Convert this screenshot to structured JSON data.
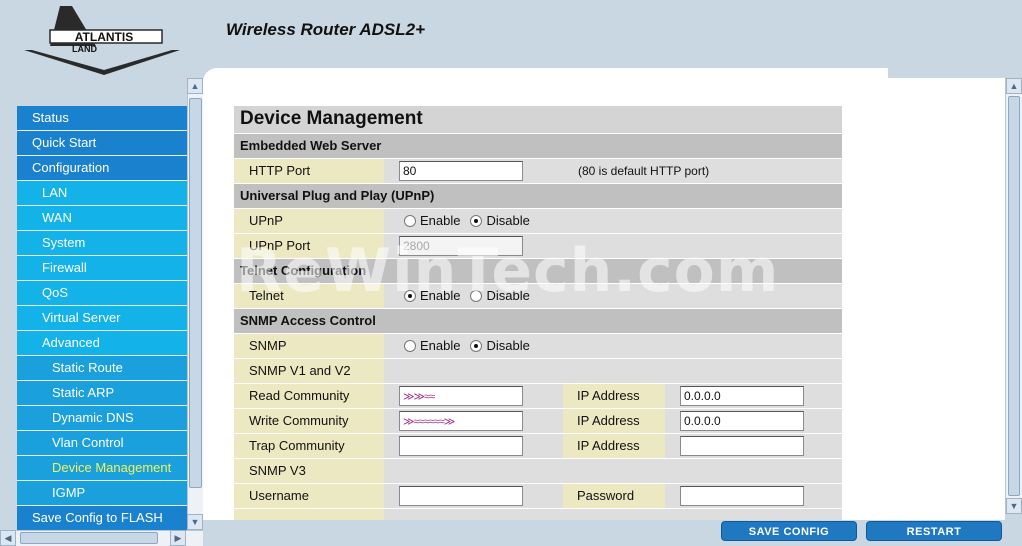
{
  "header": {
    "brand": "ATLANTIS LAND",
    "product_title": "Wireless Router ADSL2+"
  },
  "sidebar": {
    "items": [
      {
        "label": "Status",
        "level": 0
      },
      {
        "label": "Quick Start",
        "level": 0
      },
      {
        "label": "Configuration",
        "level": 0
      },
      {
        "label": "LAN",
        "level": 1
      },
      {
        "label": "WAN",
        "level": 1
      },
      {
        "label": "System",
        "level": 1
      },
      {
        "label": "Firewall",
        "level": 1
      },
      {
        "label": "QoS",
        "level": 1
      },
      {
        "label": "Virtual Server",
        "level": 1
      },
      {
        "label": "Advanced",
        "level": 1
      },
      {
        "label": "Static Route",
        "level": 2
      },
      {
        "label": "Static ARP",
        "level": 2
      },
      {
        "label": "Dynamic DNS",
        "level": 2
      },
      {
        "label": "Vlan Control",
        "level": 2
      },
      {
        "label": "Device Management",
        "level": 2,
        "active": true
      },
      {
        "label": "IGMP",
        "level": 2
      },
      {
        "label": "Save Config to FLASH",
        "level": 0
      }
    ]
  },
  "form": {
    "title": "Device Management",
    "web_server": {
      "section": "Embedded Web Server",
      "http_port_label": "HTTP Port",
      "http_port_value": "80",
      "http_port_note": "(80 is default HTTP port)"
    },
    "upnp": {
      "section": "Universal Plug and Play (UPnP)",
      "upnp_label": "UPnP",
      "enable": "Enable",
      "disable": "Disable",
      "selected": "Disable",
      "port_label": "UPnP Port",
      "port_value": "2800"
    },
    "telnet": {
      "section": "Telnet Configuration",
      "label": "Telnet",
      "enable": "Enable",
      "disable": "Disable",
      "selected": "Enable"
    },
    "snmp": {
      "section": "SNMP Access Control",
      "snmp_label": "SNMP",
      "enable": "Enable",
      "disable": "Disable",
      "selected": "Disable",
      "v1v2_label": "SNMP V1 and V2",
      "read_label": "Read Community",
      "write_label": "Write Community",
      "trap_label": "Trap Community",
      "ip_label": "IP Address",
      "read_ip": "0.0.0.0",
      "write_ip": "0.0.0.0",
      "trap_ip": "",
      "v3_label": "SNMP V3",
      "username_label": "Username",
      "password_label": "Password"
    }
  },
  "watermark": "ReWinTech.com",
  "buttons": {
    "save": "SAVE CONFIG",
    "restart": "RESTART"
  },
  "colors": {
    "sidebar_top": "#1a81ce",
    "sidebar_sub": "#13b3e9",
    "active_item": "#f2f25a",
    "button": "#1f78c0"
  }
}
